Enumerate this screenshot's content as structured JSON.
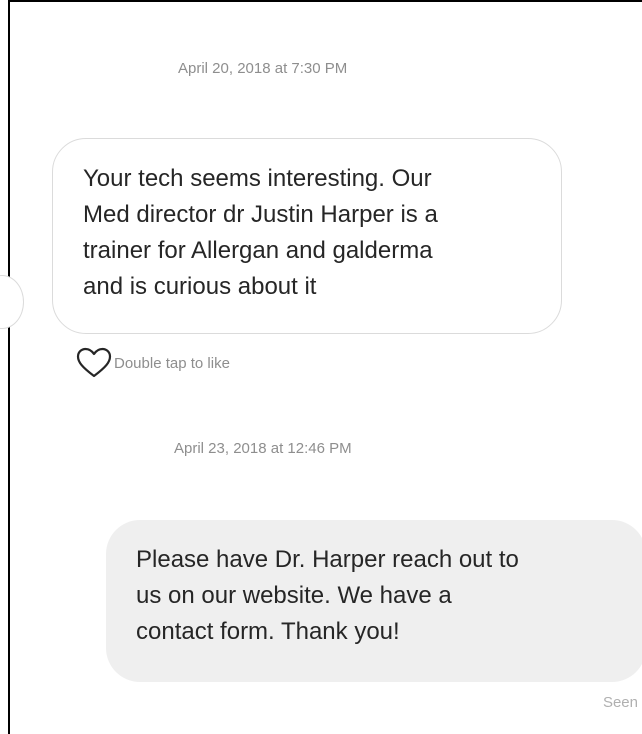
{
  "conversation": {
    "messages": [
      {
        "timestamp": "April 20, 2018 at 7:30 PM",
        "direction": "incoming",
        "lines": [
          "Your tech seems interesting. Our",
          "Med director dr Justin Harper is a",
          "trainer for Allergan and galderma",
          "and is curious about it"
        ],
        "like_hint": "Double tap to like",
        "like_icon": "heart-icon"
      },
      {
        "timestamp": "April 23, 2018 at 12:46 PM",
        "direction": "outgoing",
        "lines": [
          "Please have Dr. Harper reach out to",
          "us on our website. We have a",
          "contact form. Thank you!"
        ],
        "status": "Seen"
      }
    ]
  },
  "colors": {
    "timestamp_text": "#8e8e8e",
    "incoming_border": "#dbdbdb",
    "outgoing_bg": "#efefef",
    "message_text": "#262626",
    "seen_text": "#b0b0b0"
  }
}
